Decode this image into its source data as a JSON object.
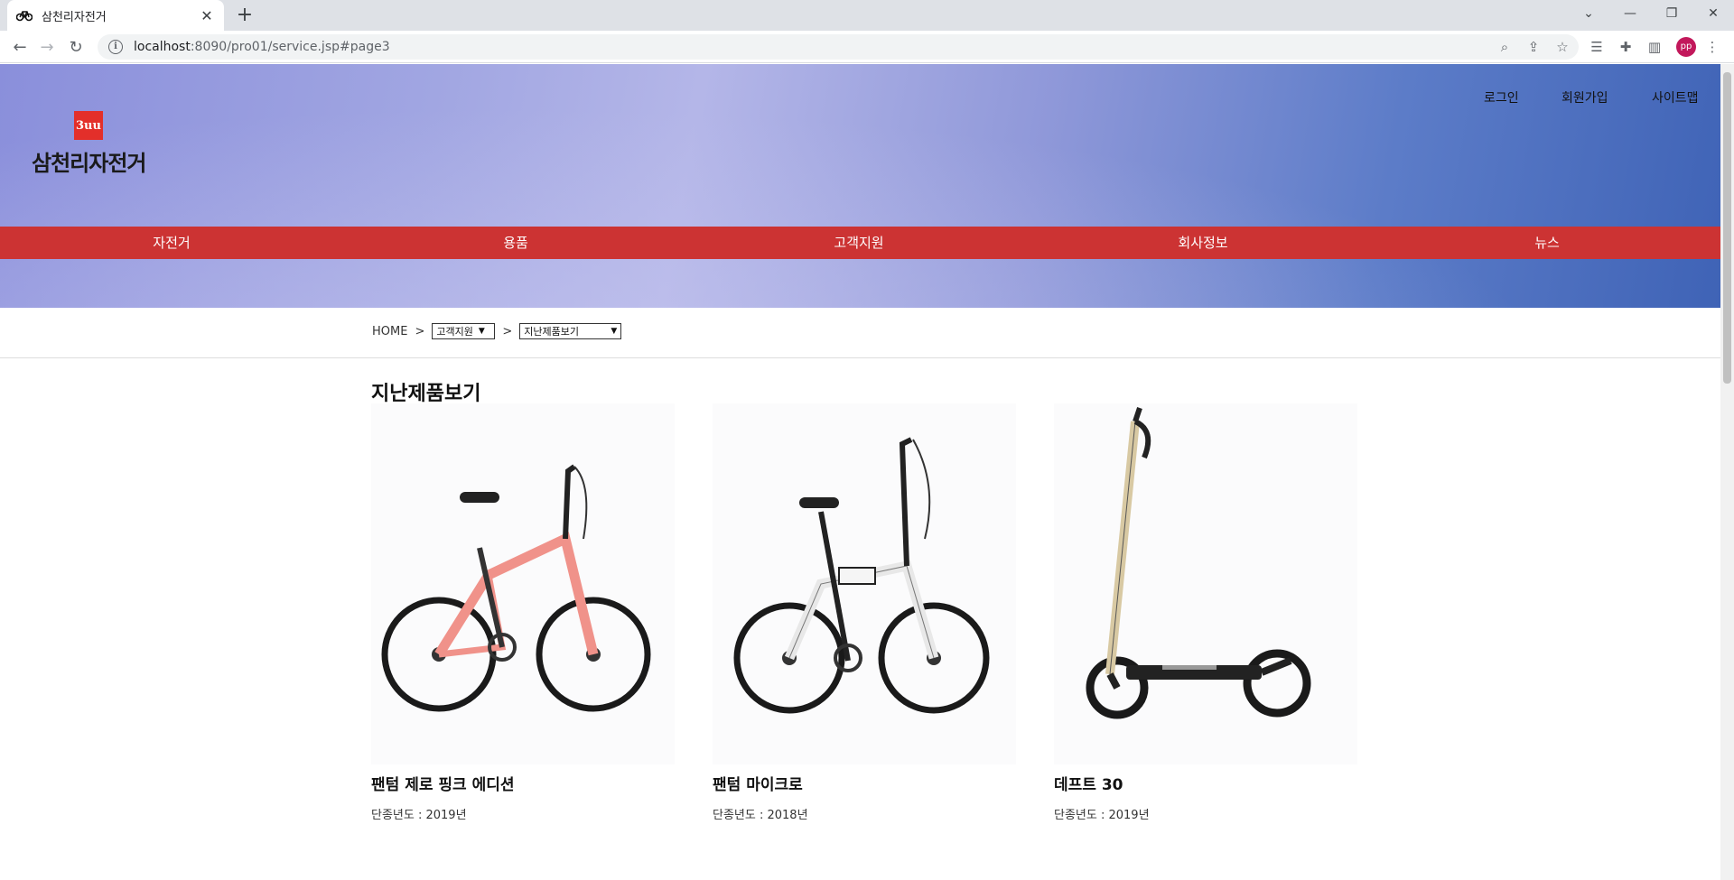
{
  "browser": {
    "tab_title": "삼천리자전거",
    "url_host": "localhost",
    "url_path": ":8090/pro01/service.jsp#page3",
    "profile_initials": "pp"
  },
  "header": {
    "logo_mark": "3uu",
    "logo_text": "삼천리자전거",
    "top_menu": [
      "로그인",
      "회원가입",
      "사이트맵"
    ]
  },
  "gnb": [
    "자전거",
    "용품",
    "고객지원",
    "회사정보",
    "뉴스"
  ],
  "breadcrumb": {
    "home": "HOME",
    "sep": ">",
    "select1": "고객지원",
    "select2": "지난제품보기"
  },
  "page_title": "지난제품보기",
  "products": [
    {
      "name": "팬텀 제로 핑크 에디션",
      "year": "단종년도 : 2019년",
      "color": "#f0928a"
    },
    {
      "name": "팬텀 마이크로",
      "year": "단종년도 : 2018년",
      "color": "#f2f2f2"
    },
    {
      "name": "데프트 30",
      "year": "단종년도 : 2019년",
      "color": "#d8c9a3"
    }
  ]
}
